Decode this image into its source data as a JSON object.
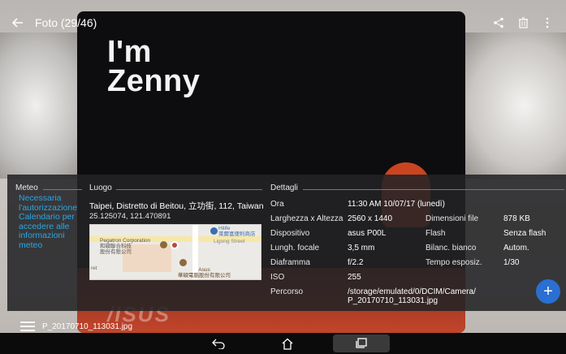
{
  "topbar": {
    "title": "Foto (29/46)",
    "back_icon": "arrow-left-icon",
    "share_icon": "share-icon",
    "delete_icon": "trash-icon",
    "more_icon": "more-vert-icon"
  },
  "photo": {
    "card_text_line1": "I'm",
    "card_text_line2": "Zenny",
    "bottom_logo": "/ISUS"
  },
  "meteo": {
    "header": "Meteo",
    "message": "Necessaria l'autorizzazione Calendario per accedere alle informazioni meteo"
  },
  "luogo": {
    "header": "Luogo",
    "address": "Taipei, Distretto di Beitou, 立功街, 112, Taiwan",
    "coordinates": "25.125074, 121.470891",
    "map_labels": {
      "pegatron": "Pegatron Corporation\n和碩聯合科技\n股份有限公司",
      "hilife": "Hilife\n萊爾富便利商店",
      "street": "Ligong Street",
      "asus": "Asus\n華碩電腦股份有限公司",
      "edge": "ret"
    }
  },
  "dettagli": {
    "header": "Dettagli",
    "rows": [
      {
        "label": "Ora",
        "value": "11:30 AM 10/07/17 (lunedì)"
      },
      {
        "label": "Larghezza x Altezza",
        "value": "2560 x 1440"
      },
      {
        "label": "Dispositivo",
        "value": "asus P00L"
      },
      {
        "label": "Lungh. focale",
        "value": "3,5 mm"
      },
      {
        "label": "Diaframma",
        "value": "f/2.2"
      },
      {
        "label": "ISO",
        "value": "255"
      },
      {
        "label": "Percorso",
        "value": "/storage/emulated/0/DCIM/Camera/\nP_20170710_113031.jpg"
      }
    ],
    "right_rows": [
      {
        "label": "Dimensioni file",
        "value": "878 KB"
      },
      {
        "label": "Flash",
        "value": "Senza flash"
      },
      {
        "label": "Bilanc. bianco",
        "value": "Autom."
      },
      {
        "label": "Tempo esposiz.",
        "value": "1/30"
      }
    ]
  },
  "filebar": {
    "filename": "P_20170710_113031.jpg",
    "menu_icon": "menu-icon"
  },
  "fab": {
    "icon": "plus-icon",
    "label": "+"
  },
  "navbar": {
    "back_icon": "nav-back-icon",
    "home_icon": "nav-home-icon",
    "recents_icon": "nav-recents-icon"
  },
  "colors": {
    "accent": "#2aa6e6",
    "fab": "#2a6fd1",
    "overlay": "#232326"
  }
}
